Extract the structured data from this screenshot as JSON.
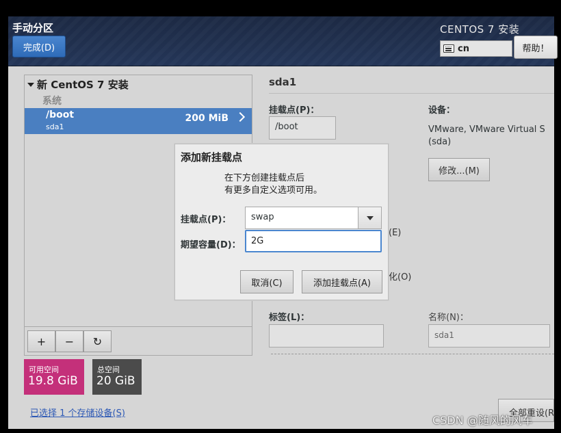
{
  "header": {
    "page_title": "手动分区",
    "done_label": "完成(D)",
    "install_title": "CENTOS 7 安装",
    "keyboard_layout": "cn",
    "help_label": "帮助！"
  },
  "left_panel": {
    "tree_header": "新 CentOS 7 安装",
    "group_label": "系统",
    "partition": {
      "name": "/boot",
      "device": "sda1",
      "size": "200 MiB"
    },
    "toolbar": {
      "add": "+",
      "remove": "−",
      "refresh": "↻"
    }
  },
  "space": {
    "available_label": "可用空间",
    "available_value": "19.8 GiB",
    "total_label": "总空间",
    "total_value": "20 GiB",
    "storage_link": "已选择 1 个存储设备(S)"
  },
  "right_panel": {
    "title": "sda1",
    "mount_label": "挂载点(P)：",
    "mount_value": "/boot",
    "device_label": "设备：",
    "device_value_line1": "VMware, VMware Virtual S",
    "device_value_line2": "(sda)",
    "modify_label": "修改...(M)",
    "encrypt_fragment": "(E)",
    "reformat_fragment": "化(O)",
    "tag_label": "标签(L)：",
    "name_label": "名称(N)：",
    "name_value": "sda1",
    "reset_label": "全部重设(R)"
  },
  "dialog": {
    "title": "添加新挂载点",
    "desc_line1": "在下方创建挂载点后",
    "desc_line2": "有更多自定义选项可用。",
    "mount_label": "挂载点(P)：",
    "mount_value": "swap",
    "capacity_label": "期望容量(D)：",
    "capacity_value": "2G",
    "cancel_label": "取消(C)",
    "add_label": "添加挂载点(A)"
  },
  "watermark": "CSDN @随风的风车"
}
